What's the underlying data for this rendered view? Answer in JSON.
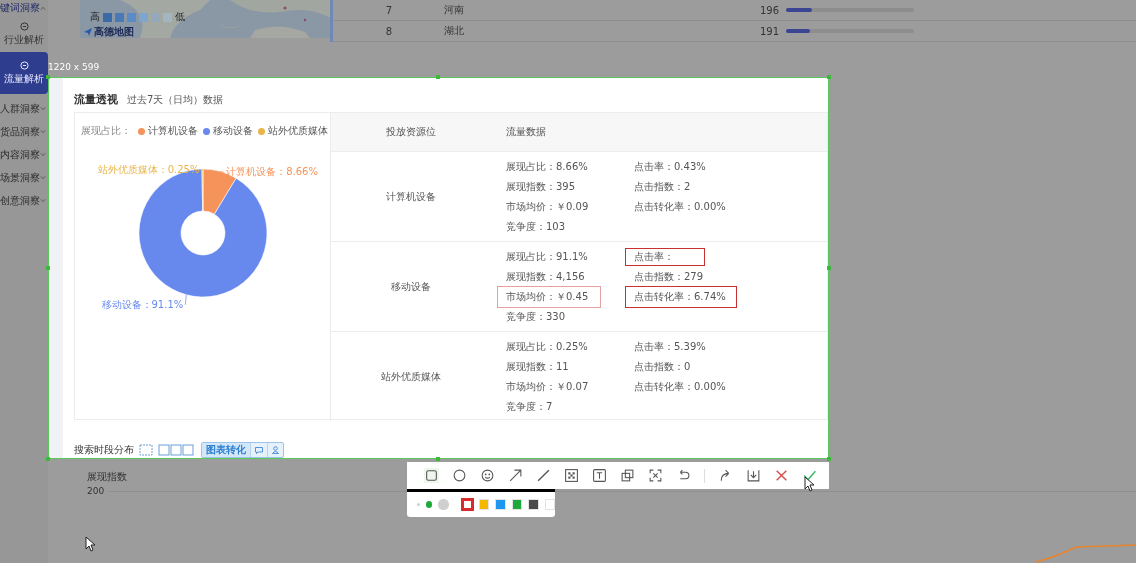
{
  "sidebar": {
    "items": [
      {
        "label": "键词洞察",
        "kind": "group",
        "expanded": true
      },
      {
        "label": "行业解析",
        "kind": "sub",
        "selected": false
      },
      {
        "label": "流量解析",
        "kind": "sub",
        "selected": true
      },
      {
        "label": "人群洞察",
        "kind": "group",
        "expanded": false
      },
      {
        "label": "货品洞察",
        "kind": "group",
        "expanded": false
      },
      {
        "label": "内容洞察",
        "kind": "group",
        "expanded": false
      },
      {
        "label": "场景洞察",
        "kind": "group",
        "expanded": false
      },
      {
        "label": "创意洞察",
        "kind": "group",
        "expanded": false
      }
    ]
  },
  "map": {
    "legend_high": "高",
    "legend_low": "低",
    "logo": "高德地图"
  },
  "region_table": {
    "rows": [
      {
        "rank": "7",
        "province": "河南",
        "value": "196",
        "level": 0.2
      },
      {
        "rank": "8",
        "province": "湖北",
        "value": "191",
        "level": 0.19
      }
    ]
  },
  "capture": {
    "size_label": "1220 x 599",
    "traffic": {
      "title": "流量透视",
      "subtitle": "过去7天（日均）数据",
      "legend_label": "展现占比：",
      "chart_data": {
        "type": "donut",
        "categories": [
          "计算机设备",
          "移动设备",
          "站外优质媒体"
        ],
        "values": [
          8.66,
          91.1,
          0.25
        ],
        "colors": [
          "#f5935a",
          "#6789ee",
          "#e8b54a"
        ],
        "value_labels": [
          "计算机设备：8.66%",
          "移动设备：91.1%",
          "站外优质媒体：0.25%"
        ]
      },
      "columns": [
        "投放资源位",
        "流量数据"
      ],
      "rows": [
        {
          "name": "计算机设备",
          "left": [
            "展现占比：8.66%",
            "展现指数：395",
            "市场均价：￥0.09",
            "竞争度：103"
          ],
          "right": [
            "点击率：0.43%",
            "点击指数：2",
            "点击转化率：0.00%"
          ]
        },
        {
          "name": "移动设备",
          "left": [
            "展现占比：91.1%",
            "展现指数：4,156",
            "市场均价：￥0.45",
            "竞争度：330"
          ],
          "right": [
            "点击率：",
            "点击指数：279",
            "点击转化率：6.74%"
          ]
        },
        {
          "name": "站外优质媒体",
          "left": [
            "展现占比：0.25%",
            "展现指数：11",
            "市场均价：￥0.07",
            "竞争度：7"
          ],
          "right": [
            "点击率：5.39%",
            "点击指数：0",
            "点击转化率：0.00%"
          ]
        }
      ]
    },
    "search_section": {
      "title": "搜索时段分布",
      "tabs": [
        {
          "kind": "text",
          "label": "图表转化",
          "selected": true
        },
        {
          "kind": "comment",
          "selected": false
        },
        {
          "kind": "user",
          "selected": false
        }
      ]
    }
  },
  "trend_chart": {
    "ylabel": "展现指数",
    "ytick": "200"
  },
  "toolbar": {
    "tools": [
      {
        "kind": "rectangle",
        "selected": true
      },
      {
        "kind": "ellipse",
        "selected": false
      },
      {
        "kind": "emoji",
        "selected": false
      },
      {
        "kind": "arrow",
        "selected": false
      },
      {
        "kind": "line",
        "selected": false
      },
      {
        "kind": "mosaic",
        "selected": false
      },
      {
        "kind": "text",
        "selected": false
      },
      {
        "kind": "pin",
        "selected": false
      },
      {
        "kind": "ocr",
        "selected": false
      },
      {
        "kind": "undo",
        "selected": false
      },
      {
        "kind": "separator"
      },
      {
        "kind": "redo",
        "selected": false
      },
      {
        "kind": "save",
        "selected": false
      },
      {
        "kind": "cancel",
        "selected": false
      },
      {
        "kind": "confirm",
        "selected": false
      }
    ],
    "sizes": [
      {
        "kind": "small",
        "selected": false
      },
      {
        "kind": "medium",
        "selected": true
      },
      {
        "kind": "large",
        "selected": false
      }
    ],
    "colors": [
      {
        "color": "#d92b2b",
        "selected": true
      },
      {
        "color": "#f5b800",
        "selected": false
      },
      {
        "color": "#1f96f0",
        "selected": false
      },
      {
        "color": "#1eaa3a",
        "selected": false
      },
      {
        "color": "#4a4a4a",
        "selected": false
      },
      {
        "color": "#ffffff",
        "selected": false
      }
    ]
  }
}
